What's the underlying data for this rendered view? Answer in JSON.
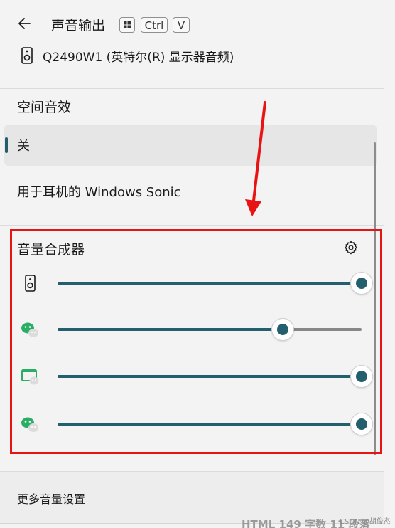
{
  "header": {
    "back_icon": "arrow-left-icon",
    "title": "声音输出",
    "shortcut_key_ctrl": "Ctrl",
    "shortcut_key_v": "V",
    "shortcut_icon": "windows-logo-icon"
  },
  "device": {
    "icon": "speaker-icon",
    "name": "Q2490W1 (英特尔(R) 显示器音频)"
  },
  "spatial_audio": {
    "title": "空间音效",
    "options": [
      {
        "label": "关",
        "selected": true
      },
      {
        "label": "用于耳机的 Windows Sonic",
        "selected": false
      }
    ]
  },
  "mixer": {
    "title": "音量合成器",
    "settings_icon": "gear-icon",
    "rows": [
      {
        "icon": "speaker-icon",
        "level": 1.0
      },
      {
        "icon": "wechat-icon",
        "level": 0.74
      },
      {
        "icon": "screen-share-icon",
        "level": 1.0
      },
      {
        "icon": "wechat-icon",
        "level": 1.0
      }
    ]
  },
  "footer": {
    "link": "更多音量设置"
  },
  "watermark": {
    "left": "HTML",
    "count": "149",
    "mid": "字数",
    "num": "11",
    "right": "段落",
    "csdn": "CSDN @胡俊杰"
  },
  "colors": {
    "accent": "#235f6d",
    "highlight": "#e81414",
    "track": "#878787"
  }
}
